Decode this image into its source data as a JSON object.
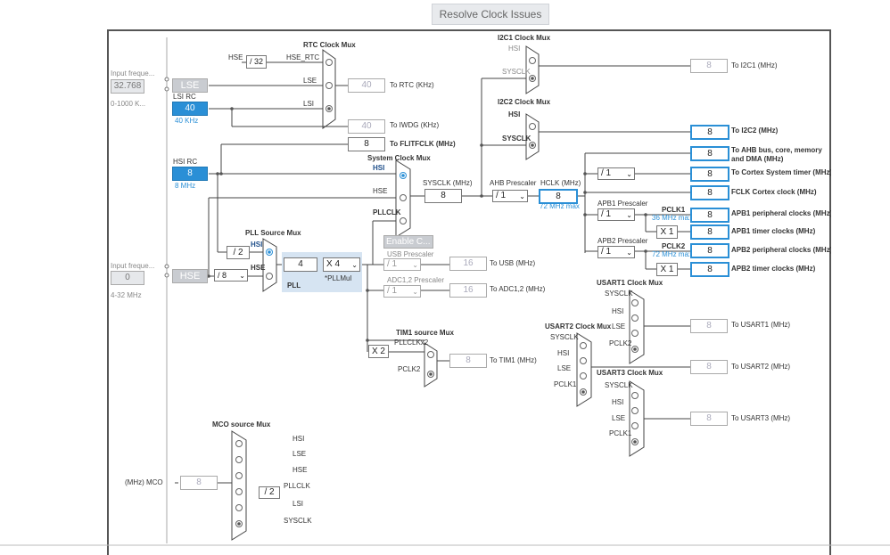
{
  "toolbar": {
    "resolve_label": "Resolve Clock Issues"
  },
  "lse": {
    "input_label": "Input freque...",
    "input_value": "32.768",
    "range": "0-1000 K...",
    "name": "LSE"
  },
  "lsi": {
    "label": "LSI RC",
    "value": "40",
    "sub": "40 KHz"
  },
  "hsi": {
    "label": "HSI RC",
    "value": "8",
    "sub": "8 MHz"
  },
  "hse": {
    "input_label": "Input freque...",
    "input_value": "0",
    "range": "4-32 MHz",
    "name": "HSE",
    "div": "/ 8"
  },
  "rtc": {
    "title": "RTC Clock Mux",
    "in_hse": "HSE",
    "div": "/ 32",
    "hse_rtc": "HSE_RTC",
    "in_lse": "LSE",
    "in_lsi": "LSI",
    "out_value": "40",
    "out_label": "To RTC (KHz)"
  },
  "iwdg": {
    "value": "40",
    "label": "To IWDG (KHz)"
  },
  "flit": {
    "value": "8",
    "label": "To FLITFCLK (MHz)"
  },
  "sysmux": {
    "title": "System Clock Mux",
    "hsi": "HSI",
    "hse": "HSE",
    "pllclk": "PLLCLK",
    "enable": "Enable C..."
  },
  "pllsrc": {
    "title": "PLL Source Mux",
    "div2": "/ 2",
    "hsi": "HSI",
    "hse": "HSE"
  },
  "pll": {
    "value": "4",
    "mul": "X 4",
    "mul_label": "*PLLMul",
    "label": "PLL"
  },
  "sysclk": {
    "label": "SYSCLK (MHz)",
    "value": "8"
  },
  "ahb": {
    "label": "AHB Prescaler",
    "value": "/ 1"
  },
  "hclk": {
    "label": "HCLK (MHz)",
    "value": "8",
    "max": "72 MHz max"
  },
  "usb": {
    "label": "USB Prescaler",
    "value": "/ 1",
    "out": "16",
    "out_label": "To USB (MHz)"
  },
  "adc": {
    "label": "ADC1,2 Prescaler",
    "value": "/ 1",
    "out": "16",
    "out_label": "To ADC1,2 (MHz)"
  },
  "tim1": {
    "title": "TIM1 source Mux",
    "x2": "X 2",
    "pllclk2": "PLLCLKx2",
    "pclk2": "PCLK2",
    "out": "8",
    "out_label": "To TIM1 (MHz)"
  },
  "i2c1": {
    "title": "I2C1 Clock Mux",
    "hsi": "HSI",
    "sysclk": "SYSCLK",
    "out": "8",
    "out_label": "To I2C1 (MHz)"
  },
  "i2c2": {
    "title": "I2C2 Clock Mux",
    "hsi": "HSI",
    "sysclk": "SYSCLK",
    "out": "8",
    "out_label": "To I2C2 (MHz)"
  },
  "ahbout": {
    "value": "8",
    "label": "To AHB bus, core, memory and DMA (MHz)"
  },
  "cortex": {
    "div": "/ 1",
    "value": "8",
    "label": "To Cortex System timer (MHz)"
  },
  "fclk": {
    "value": "8",
    "label": "FCLK Cortex clock (MHz)"
  },
  "apb1": {
    "label": "APB1 Prescaler",
    "div": "/ 1",
    "pclk": "PCLK1",
    "max": "36 MHz max",
    "value": "8",
    "out_label": "APB1 peripheral clocks (MHz)",
    "x": "X 1",
    "timer_value": "8",
    "timer_label": "APB1 timer clocks (MHz)"
  },
  "apb2": {
    "label": "APB2 Prescaler",
    "div": "/ 1",
    "pclk": "PCLK2",
    "max": "72 MHz max",
    "value": "8",
    "out_label": "APB2 peripheral clocks (MHz)",
    "x": "X 1",
    "timer_value": "8",
    "timer_label": "APB2 timer clocks (MHz)"
  },
  "usart1": {
    "title": "USART1 Clock Mux",
    "sysclk": "SYSCLK",
    "hsi": "HSI",
    "lse": "LSE",
    "pclk": "PCLK2",
    "out": "8",
    "out_label": "To USART1 (MHz)"
  },
  "usart2": {
    "title": "USART2 Clock Mux",
    "sysclk": "SYSCLK",
    "hsi": "HSI",
    "lse": "LSE",
    "pclk": "PCLK1",
    "out": "8",
    "out_label": "To USART2 (MHz)"
  },
  "usart3": {
    "title": "USART3 Clock Mux",
    "sysclk": "SYSCLK",
    "hsi": "HSI",
    "lse": "LSE",
    "pclk": "PCLK1",
    "out": "8",
    "out_label": "To USART3 (MHz)"
  },
  "mco": {
    "title": "MCO source Mux",
    "hsi": "HSI",
    "lse": "LSE",
    "hse": "HSE",
    "pllclk": "PLLCLK",
    "div": "/ 2",
    "lsi": "LSI",
    "sysclk": "SYSCLK",
    "out": "8",
    "out_label": "(MHz) MCO"
  },
  "colors": {
    "accent": "#2a8fd6",
    "line": "#444444",
    "panel": "#d6e4f2"
  }
}
